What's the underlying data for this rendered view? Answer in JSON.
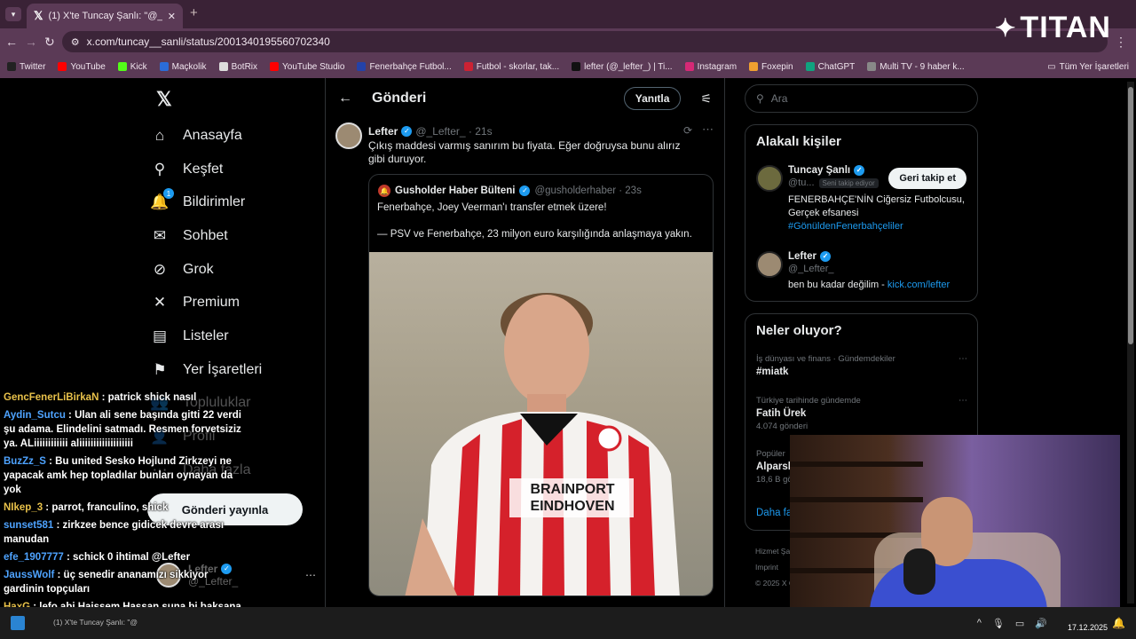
{
  "browser": {
    "tab_title": "(1) X'te Tuncay Şanlı: \"@_Lefter",
    "url": "x.com/tuncay__sanli/status/2001340195560702340",
    "bookmarks": [
      {
        "label": "Twitter",
        "color": "#222"
      },
      {
        "label": "YouTube",
        "color": "#ff0000"
      },
      {
        "label": "Kick",
        "color": "#53fc18"
      },
      {
        "label": "Maçkolik",
        "color": "#2b6cd8"
      },
      {
        "label": "BotRix",
        "color": "#ddd"
      },
      {
        "label": "YouTube Studio",
        "color": "#ff0000"
      },
      {
        "label": "Fenerbahçe Futbol...",
        "color": "#2442a8"
      },
      {
        "label": "Futbol - skorlar, tak...",
        "color": "#c23"
      },
      {
        "label": "lefter (@_lefter_) | Ti...",
        "color": "#111"
      },
      {
        "label": "Instagram",
        "color": "#d62976"
      },
      {
        "label": "Foxepin",
        "color": "#f0a030"
      },
      {
        "label": "ChatGPT",
        "color": "#10a37f"
      },
      {
        "label": "Multi TV - 9 haber k...",
        "color": "#888"
      }
    ],
    "all_bookmarks": "Tüm Yer İşaretleri"
  },
  "overlay_logo": "TITAN",
  "nav": {
    "items": [
      {
        "label": "Anasayfa",
        "icon": "home-icon",
        "glyph": "⌂"
      },
      {
        "label": "Keşfet",
        "icon": "search-icon",
        "glyph": "⚲"
      },
      {
        "label": "Bildirimler",
        "icon": "bell-icon",
        "glyph": "🔔",
        "badge": "1"
      },
      {
        "label": "Sohbet",
        "icon": "mail-icon",
        "glyph": "✉"
      },
      {
        "label": "Grok",
        "icon": "grok-icon",
        "glyph": "⊘"
      },
      {
        "label": "Premium",
        "icon": "x-icon",
        "glyph": "✕"
      },
      {
        "label": "Listeler",
        "icon": "list-icon",
        "glyph": "▤"
      },
      {
        "label": "Yer İşaretleri",
        "icon": "bookmark-icon",
        "glyph": "⚑"
      },
      {
        "label": "Topluluklar",
        "icon": "people-icon",
        "glyph": "👥"
      },
      {
        "label": "Profil",
        "icon": "person-icon",
        "glyph": "👤"
      },
      {
        "label": "Daha fazla",
        "icon": "more-icon",
        "glyph": "⋯"
      }
    ],
    "post_button": "Gönderi yayınla",
    "me_name": "Lefter",
    "me_handle": "@_Lefter_"
  },
  "main": {
    "title": "Gönderi",
    "reply_button": "Yanıtla",
    "tweet": {
      "name": "Lefter",
      "handle": "@_Lefter_ · 21s",
      "text": "Çıkış maddesi varmış sanırım bu fiyata. Eğer doğruysa bunu alırız gibi duruyor.",
      "quote": {
        "name": "Gusholder Haber Bülteni",
        "handle": "@gusholderhaber · 23s",
        "line1": "Fenerbahçe, Joey Veerman'ı transfer etmek üzere!",
        "line2": "— PSV ve Fenerbahçe, 23 milyon euro karşılığında anlaşmaya yakın.",
        "jersey_text": "BRAINPORT EINDHOVEN"
      }
    }
  },
  "right": {
    "search_placeholder": "Ara",
    "related_title": "Alakalı kişiler",
    "people": [
      {
        "name": "Tuncay Şanlı",
        "handle": "@tu...",
        "follows": "Seni takip ediyor",
        "bio": "FENERBAHÇE'NİN Ciğersiz Futbolcusu, Gerçek efsanesi",
        "tag": "#GönüldenFenerbahçeliler",
        "button": "Geri takip et"
      },
      {
        "name": "Lefter",
        "handle": "@_Lefter_",
        "bio": "ben bu kadar değilim - ",
        "link": "kick.com/lefter"
      }
    ],
    "trends_title": "Neler oluyor?",
    "trends": [
      {
        "cat": "İş dünyası ve finans · Gündemdekiler",
        "name": "#miatk",
        "count": ""
      },
      {
        "cat": "Türkiye tarihinde gündemde",
        "name": "Fatih Ürek",
        "count": "4.074 gönderi"
      },
      {
        "cat": "Popüler",
        "name": "Alparsl",
        "count": "18,6 B gö"
      }
    ],
    "show_more": "Daha fa",
    "footer1": "Hizmet Şa",
    "footer2": "Imprint",
    "footer3": "© 2025 X C"
  },
  "chat": [
    {
      "user": "GencFenerLiBirkaN",
      "color": "y",
      "msg": "patrick shick nasıl"
    },
    {
      "user": "Aydin_Sutcu",
      "color": "b",
      "msg": "Ulan ali sene başında gitti 22 verdi şu adama. Elindelini satmadı. Resmen forvetsiziz ya. ALiiiiiiiiiiii aliiiiiiiiiiiiiiiiiii"
    },
    {
      "user": "BuzZz_S",
      "color": "b",
      "msg": "Bu united Sesko Hojlund Zirkzeyi ne yapacak amk hep topladılar bunları oynayan da yok"
    },
    {
      "user": "NIkep_3",
      "color": "y",
      "msg": "parrot, franculino, shick"
    },
    {
      "user": "sunset581",
      "color": "b",
      "msg": "zirkzee bence gidicek devre arası manudan"
    },
    {
      "user": "efe_1907777",
      "color": "b",
      "msg": "schick 0 ihtimal @Lefter"
    },
    {
      "user": "JaussWolf",
      "color": "b",
      "msg": "üç senedir ananamızı sikkiyor gardinin topçuları"
    },
    {
      "user": "HaxG",
      "color": "y",
      "msg": "lefo abi Haissem Hassan şuna bi baksana sağ kanat için"
    }
  ],
  "taskbar": {
    "item": "(1) X'te Tuncay Şanlı: \"@",
    "time": "20:55",
    "date": "17.12.2025"
  }
}
